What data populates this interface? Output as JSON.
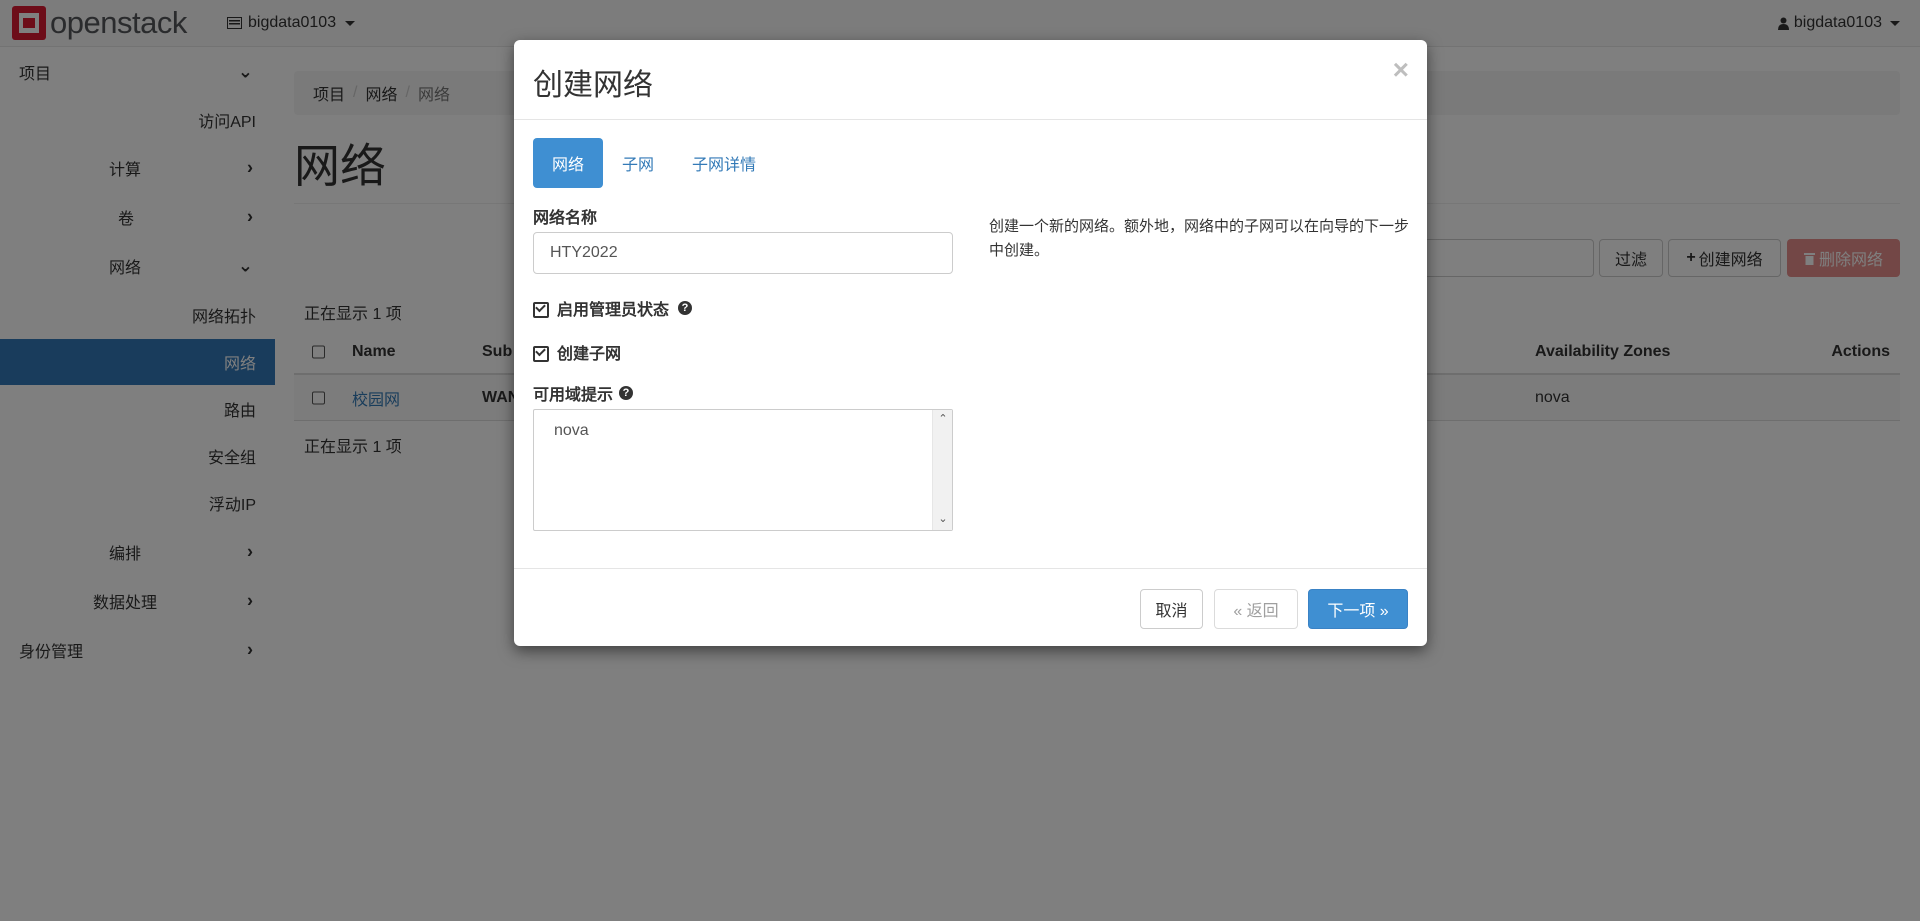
{
  "topbar": {
    "logo_text": "openstack",
    "project": "bigdata0103",
    "user": "bigdata0103"
  },
  "sidebar": {
    "items": [
      {
        "label": "项目",
        "chevron": "down"
      },
      {
        "label": "访问API",
        "chevron": ""
      },
      {
        "label": "计算",
        "chevron": "right"
      },
      {
        "label": "卷",
        "chevron": "right"
      },
      {
        "label": "网络",
        "chevron": "down"
      },
      {
        "label": "网络拓扑",
        "chevron": ""
      },
      {
        "label": "网络",
        "chevron": "",
        "active": true
      },
      {
        "label": "路由",
        "chevron": ""
      },
      {
        "label": "安全组",
        "chevron": ""
      },
      {
        "label": "浮动IP",
        "chevron": ""
      },
      {
        "label": "编排",
        "chevron": "right"
      },
      {
        "label": "数据处理",
        "chevron": "right"
      },
      {
        "label": "身份管理",
        "chevron": "right"
      }
    ]
  },
  "main": {
    "breadcrumb": [
      "项目",
      "网络",
      "网络"
    ],
    "title": "网络",
    "filter_label": "过滤",
    "create_label": "创建网络",
    "delete_label": "删除网络",
    "count_top": "正在显示 1 项",
    "count_bottom": "正在显示 1 项",
    "table": {
      "headers": [
        "Name",
        "Sub",
        "Availability Zones",
        "Actions"
      ],
      "rows": [
        {
          "name": "校园网",
          "subnet": "WAN",
          "zones": "nova"
        }
      ]
    }
  },
  "modal": {
    "title": "创建网络",
    "close": "×",
    "tabs": [
      "网络",
      "子网",
      "子网详情"
    ],
    "network_name_label": "网络名称",
    "network_name_value": "HTY2022",
    "admin_state_label": "启用管理员状态",
    "create_subnet_label": "创建子网",
    "az_hint_label": "可用域提示",
    "az_hint_value": "nova",
    "help_text": "创建一个新的网络。额外地，网络中的子网可以在向导的下一步中创建。",
    "cancel_label": "取消",
    "back_label": "« 返回",
    "next_label": "下一项 »"
  }
}
